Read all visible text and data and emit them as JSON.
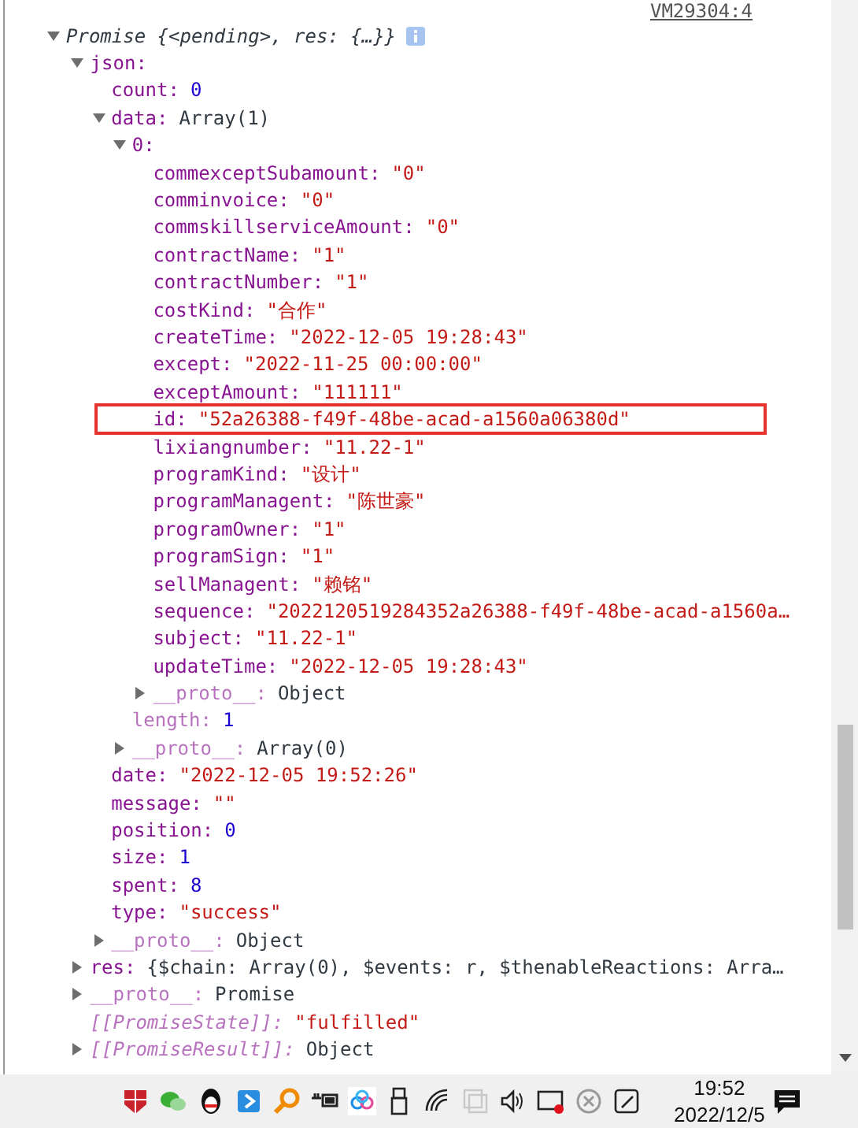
{
  "console": {
    "source_link": "VM29304:4",
    "root": {
      "label": "Promise {<pending>, res: {…}}",
      "expanded": true,
      "children": [
        {
          "key": {
            "text": "json:",
            "kind": "own"
          },
          "expanded": true,
          "children": [
            {
              "key": {
                "text": "count:",
                "kind": "own"
              },
              "value": {
                "text": "0",
                "kind": "number"
              }
            },
            {
              "key": {
                "text": "data:",
                "kind": "own"
              },
              "value": {
                "text": "Array(1)",
                "kind": "object"
              },
              "expanded": true,
              "children": [
                {
                  "key": {
                    "text": "0:",
                    "kind": "own"
                  },
                  "expanded": true,
                  "children": [
                    {
                      "key": {
                        "text": "commexceptSubamount:",
                        "kind": "own"
                      },
                      "value": {
                        "text": "\"0\"",
                        "kind": "string"
                      }
                    },
                    {
                      "key": {
                        "text": "comminvoice:",
                        "kind": "own"
                      },
                      "value": {
                        "text": "\"0\"",
                        "kind": "string"
                      }
                    },
                    {
                      "key": {
                        "text": "commskillserviceAmount:",
                        "kind": "own"
                      },
                      "value": {
                        "text": "\"0\"",
                        "kind": "string"
                      }
                    },
                    {
                      "key": {
                        "text": "contractName:",
                        "kind": "own"
                      },
                      "value": {
                        "text": "\"1\"",
                        "kind": "string"
                      }
                    },
                    {
                      "key": {
                        "text": "contractNumber:",
                        "kind": "own"
                      },
                      "value": {
                        "text": "\"1\"",
                        "kind": "string"
                      }
                    },
                    {
                      "key": {
                        "text": "costKind:",
                        "kind": "own"
                      },
                      "value": {
                        "text": "\"合作\"",
                        "kind": "string"
                      }
                    },
                    {
                      "key": {
                        "text": "createTime:",
                        "kind": "own"
                      },
                      "value": {
                        "text": "\"2022-12-05 19:28:43\"",
                        "kind": "string"
                      }
                    },
                    {
                      "key": {
                        "text": "except:",
                        "kind": "own"
                      },
                      "value": {
                        "text": "\"2022-11-25 00:00:00\"",
                        "kind": "string"
                      }
                    },
                    {
                      "key": {
                        "text": "exceptAmount:",
                        "kind": "own"
                      },
                      "value": {
                        "text": "\"111111\"",
                        "kind": "string"
                      }
                    },
                    {
                      "key": {
                        "text": "id:",
                        "kind": "own"
                      },
                      "value": {
                        "text": "\"52a26388-f49f-48be-acad-a1560a06380d\"",
                        "kind": "string"
                      },
                      "boxed": true
                    },
                    {
                      "key": {
                        "text": "lixiangnumber:",
                        "kind": "own"
                      },
                      "value": {
                        "text": "\"11.22-1\"",
                        "kind": "string"
                      }
                    },
                    {
                      "key": {
                        "text": "programKind:",
                        "kind": "own"
                      },
                      "value": {
                        "text": "\"设计\"",
                        "kind": "string"
                      }
                    },
                    {
                      "key": {
                        "text": "programManagent:",
                        "kind": "own"
                      },
                      "value": {
                        "text": "\"陈世豪\"",
                        "kind": "string"
                      }
                    },
                    {
                      "key": {
                        "text": "programOwner:",
                        "kind": "own"
                      },
                      "value": {
                        "text": "\"1\"",
                        "kind": "string"
                      }
                    },
                    {
                      "key": {
                        "text": "programSign:",
                        "kind": "own"
                      },
                      "value": {
                        "text": "\"1\"",
                        "kind": "string"
                      }
                    },
                    {
                      "key": {
                        "text": "sellManagent:",
                        "kind": "own"
                      },
                      "value": {
                        "text": "\"赖铭\"",
                        "kind": "string"
                      }
                    },
                    {
                      "key": {
                        "text": "sequence:",
                        "kind": "own"
                      },
                      "value": {
                        "text": "\"2022120519284352a26388-f49f-48be-acad-a1560a…",
                        "kind": "string"
                      }
                    },
                    {
                      "key": {
                        "text": "subject:",
                        "kind": "own"
                      },
                      "value": {
                        "text": "\"11.22-1\"",
                        "kind": "string"
                      }
                    },
                    {
                      "key": {
                        "text": "updateTime:",
                        "kind": "own"
                      },
                      "value": {
                        "text": "\"2022-12-05 19:28:43\"",
                        "kind": "string"
                      }
                    },
                    {
                      "key": {
                        "text": "__proto__:",
                        "kind": "hidden"
                      },
                      "value": {
                        "text": "Object",
                        "kind": "object"
                      },
                      "expanded": false
                    }
                  ]
                },
                {
                  "key": {
                    "text": "length:",
                    "kind": "hidden"
                  },
                  "value": {
                    "text": "1",
                    "kind": "number"
                  }
                },
                {
                  "key": {
                    "text": "__proto__:",
                    "kind": "hidden"
                  },
                  "value": {
                    "text": "Array(0)",
                    "kind": "object"
                  },
                  "expanded": false
                }
              ]
            },
            {
              "key": {
                "text": "date:",
                "kind": "own"
              },
              "value": {
                "text": "\"2022-12-05 19:52:26\"",
                "kind": "string"
              }
            },
            {
              "key": {
                "text": "message:",
                "kind": "own"
              },
              "value": {
                "text": "\"\"",
                "kind": "string"
              }
            },
            {
              "key": {
                "text": "position:",
                "kind": "own"
              },
              "value": {
                "text": "0",
                "kind": "number"
              }
            },
            {
              "key": {
                "text": "size:",
                "kind": "own"
              },
              "value": {
                "text": "1",
                "kind": "number"
              }
            },
            {
              "key": {
                "text": "spent:",
                "kind": "own"
              },
              "value": {
                "text": "8",
                "kind": "number"
              }
            },
            {
              "key": {
                "text": "type:",
                "kind": "own"
              },
              "value": {
                "text": "\"success\"",
                "kind": "string"
              }
            },
            {
              "key": {
                "text": "__proto__:",
                "kind": "hidden"
              },
              "value": {
                "text": "Object",
                "kind": "object"
              },
              "expanded": false
            }
          ]
        },
        {
          "key": {
            "text": "res:",
            "kind": "own"
          },
          "value": {
            "text": "{$chain: Array(0), $events: r, $thenableReactions: Arra…",
            "kind": "object"
          },
          "expanded": false
        },
        {
          "key": {
            "text": "__proto__:",
            "kind": "hidden"
          },
          "value": {
            "text": "Promise",
            "kind": "object"
          },
          "expanded": false
        },
        {
          "key": {
            "text": "[[PromiseState]]:",
            "kind": "internal"
          },
          "value": {
            "text": "\"fulfilled\"",
            "kind": "string"
          }
        },
        {
          "key": {
            "text": "[[PromiseResult]]:",
            "kind": "internal"
          },
          "value": {
            "text": "Object",
            "kind": "object"
          },
          "expanded": false
        }
      ]
    }
  },
  "taskbar": {
    "time": "19:52",
    "date": "2022/12/5"
  }
}
